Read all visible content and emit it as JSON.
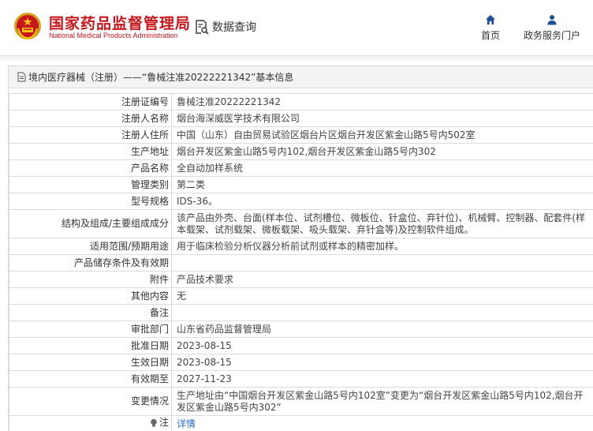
{
  "header": {
    "brand_cn": "国家药品监督管理局",
    "brand_en": "National Medical Products Administration",
    "data_query": "数据查询",
    "nav": [
      {
        "label": "首页",
        "icon": "home-icon"
      },
      {
        "label": "政务服务门户",
        "icon": "user-icon"
      }
    ],
    "brand_color": "#c8161d"
  },
  "panel": {
    "title": "境内医疗器械（注册）——“鲁械注准20222221342”基本信息"
  },
  "rows": [
    {
      "key": "注册证编号",
      "value": "鲁械注准20222221342"
    },
    {
      "key": "注册人名称",
      "value": "烟台海深威医学技术有限公司"
    },
    {
      "key": "注册人住所",
      "value": "中国（山东）自由贸易试验区烟台片区烟台开发区紫金山路5号内502室"
    },
    {
      "key": "生产地址",
      "value": "烟台开发区紫金山路5号内102,烟台开发区紫金山路5号内302"
    },
    {
      "key": "产品名称",
      "value": "全自动加样系统"
    },
    {
      "key": "管理类别",
      "value": "第二类"
    },
    {
      "key": "型号规格",
      "value": "IDS-36。"
    },
    {
      "key": "结构及组成/主要组成成分",
      "value": "该产品由外壳、台面(样本位、试剂槽位、微板位、针盒位、弃针位)、机械臂、控制器、配套件(样本载架、试剂载架、微板载架、吸头载架、弃针盒等)及控制软件组成。"
    },
    {
      "key": "适用范围/预期用途",
      "value": "用于临床检验分析仪器分析前试剂或样本的精密加样。"
    },
    {
      "key": "产品储存条件及有效期",
      "value": ""
    },
    {
      "key": "附件",
      "value": "产品技术要求"
    },
    {
      "key": "其他内容",
      "value": "无"
    },
    {
      "key": "备注",
      "value": ""
    },
    {
      "key": "审批部门",
      "value": "山东省药品监督管理局"
    },
    {
      "key": "批准日期",
      "value": "2023-08-15"
    },
    {
      "key": "生效日期",
      "value": "2023-08-15"
    },
    {
      "key": "有效期至",
      "value": "2027-11-23"
    },
    {
      "key": "变更情况",
      "value": "生产地址由“中国烟台开发区紫金山路5号内102室”变更为“烟台开发区紫金山路5号内102,烟台开发区紫金山路5号内302”"
    }
  ],
  "note": {
    "key": "注",
    "value": "详情",
    "icon": "bulb-icon"
  }
}
